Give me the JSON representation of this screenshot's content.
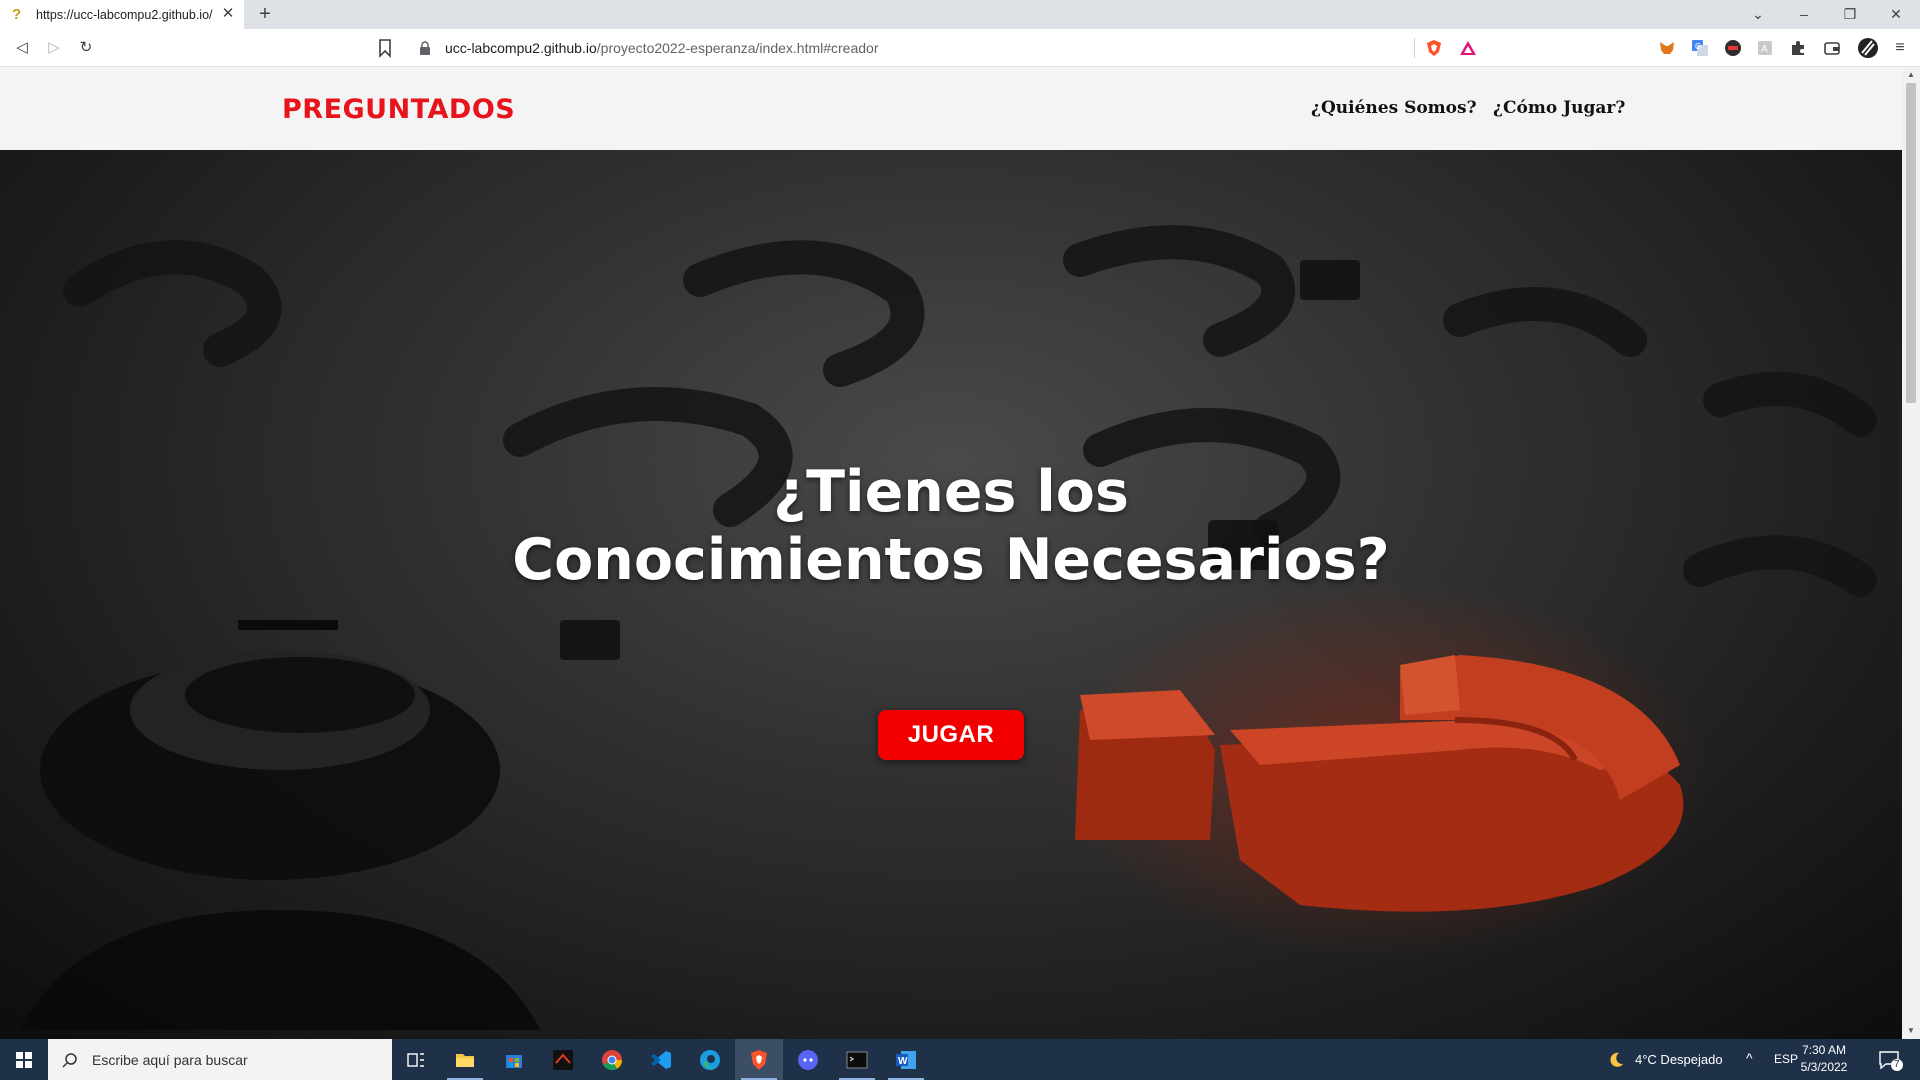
{
  "browser": {
    "tab_title": "https://ucc-labcompu2.github.io/",
    "new_tab_label": "+",
    "url_host": "ucc-labcompu2.github.io",
    "url_path": "/proyecto2022-esperanza/index.html#creador",
    "window_controls": {
      "list": "⌄",
      "minimize": "–",
      "restore": "❐",
      "close": "✕"
    },
    "nav": {
      "back": "◁",
      "forward": "▷",
      "reload": "↻"
    }
  },
  "site": {
    "logo": "PREGUNTADOS",
    "nav": [
      {
        "label": "¿Quiénes Somos?"
      },
      {
        "label": "¿Cómo Jugar?"
      }
    ],
    "hero": {
      "title_line1": "¿Tienes los",
      "title_line2": "Conocimientos Necesarios?",
      "button_label": "JUGAR"
    },
    "colors": {
      "brand_red": "#e8141b",
      "button_red": "#f20000",
      "header_bg": "#f4f4f4"
    }
  },
  "taskbar": {
    "search_placeholder": "Escribe aquí para buscar",
    "weather": "4°C  Despejado",
    "language": "ESP",
    "time": "7:30 AM",
    "date": "5/3/2022",
    "notification_count": "7",
    "apps": [
      "task-view-icon",
      "file-explorer-icon",
      "store-icon",
      "game-app-icon",
      "chrome-icon",
      "vscode-icon",
      "edge-icon",
      "brave-icon",
      "discord-icon",
      "terminal-icon",
      "word-icon"
    ]
  }
}
